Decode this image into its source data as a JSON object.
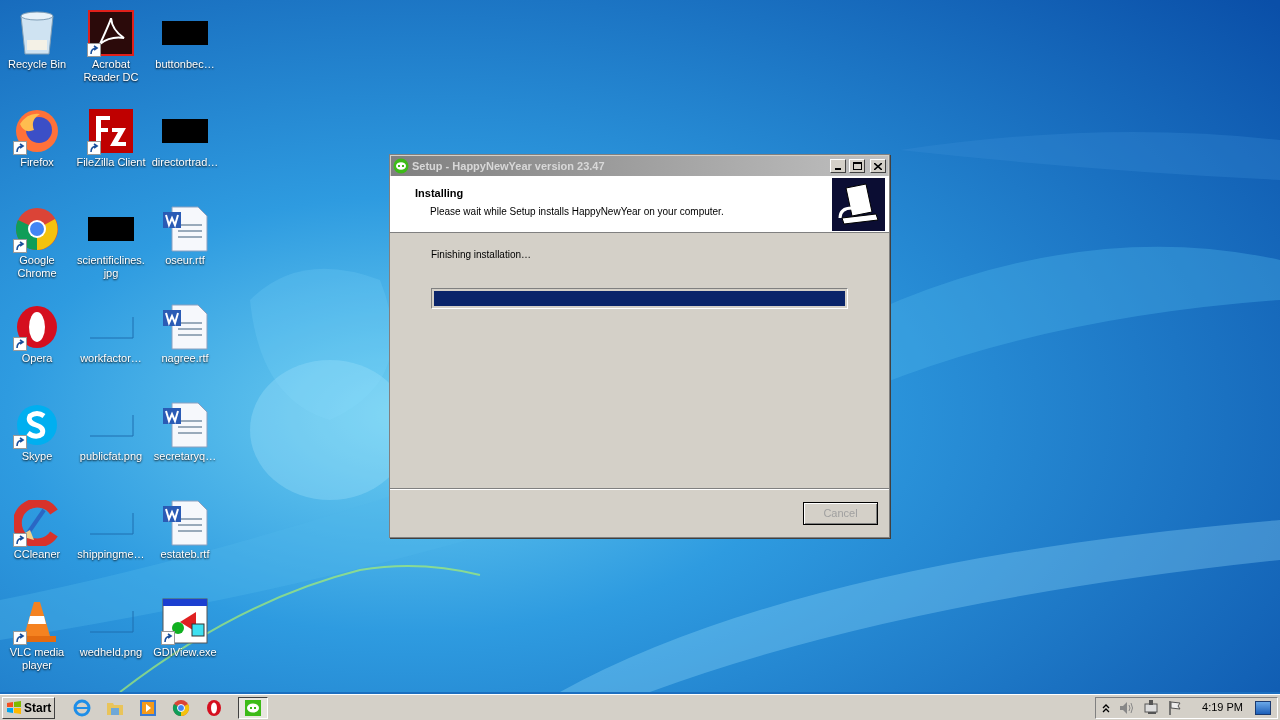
{
  "desktop": {
    "icons": [
      {
        "label": "Recycle Bin",
        "kind": "recycle",
        "shortcut": false
      },
      {
        "label": "Firefox",
        "kind": "firefox",
        "shortcut": true
      },
      {
        "label": "Google Chrome",
        "kind": "chrome",
        "shortcut": true
      },
      {
        "label": "Opera",
        "kind": "opera",
        "shortcut": true
      },
      {
        "label": "Skype",
        "kind": "skype",
        "shortcut": true
      },
      {
        "label": "CCleaner",
        "kind": "ccleaner",
        "shortcut": true
      },
      {
        "label": "VLC media player",
        "kind": "vlc",
        "shortcut": true
      },
      {
        "label": "Acrobat Reader DC",
        "kind": "acrobat",
        "shortcut": true
      },
      {
        "label": "FileZilla Client",
        "kind": "filezilla",
        "shortcut": true
      },
      {
        "label": "scientificlines.jpg",
        "kind": "dark-image",
        "shortcut": false
      },
      {
        "label": "workfactor…",
        "kind": "blank-image",
        "shortcut": false
      },
      {
        "label": "publicfat.png",
        "kind": "blank-image",
        "shortcut": false
      },
      {
        "label": "shippingme…",
        "kind": "blank-image",
        "shortcut": false
      },
      {
        "label": "wedheld.png",
        "kind": "blank-image",
        "shortcut": false
      },
      {
        "label": "buttonbec…",
        "kind": "dark-image",
        "shortcut": false
      },
      {
        "label": "directortrad…",
        "kind": "dark-image",
        "shortcut": false
      },
      {
        "label": "oseur.rtf",
        "kind": "word",
        "shortcut": false
      },
      {
        "label": "nagree.rtf",
        "kind": "word",
        "shortcut": false
      },
      {
        "label": "secretaryq…",
        "kind": "word",
        "shortcut": false
      },
      {
        "label": "estateb.rtf",
        "kind": "word",
        "shortcut": false
      },
      {
        "label": "GDIView.exe",
        "kind": "gdiview",
        "shortcut": true
      }
    ]
  },
  "dialog": {
    "title": "Setup - HappyNewYear version 23.47",
    "heading": "Installing",
    "subheading": "Please wait while Setup installs HappyNewYear on your computer.",
    "status": "Finishing installation…",
    "progress": {
      "level": 1
    },
    "buttons": [
      {
        "label": "Cancel",
        "disabled": true
      }
    ]
  },
  "taskbar": {
    "start": "Start",
    "items": [
      {
        "kind": "ie",
        "selected": false
      },
      {
        "kind": "folder",
        "selected": false
      },
      {
        "kind": "media",
        "selected": false
      },
      {
        "kind": "chrome",
        "selected": false
      },
      {
        "kind": "opera",
        "selected": false
      },
      {
        "kind": "chat",
        "selected": true
      }
    ],
    "tray": {
      "time": "4:19 PM"
    }
  }
}
